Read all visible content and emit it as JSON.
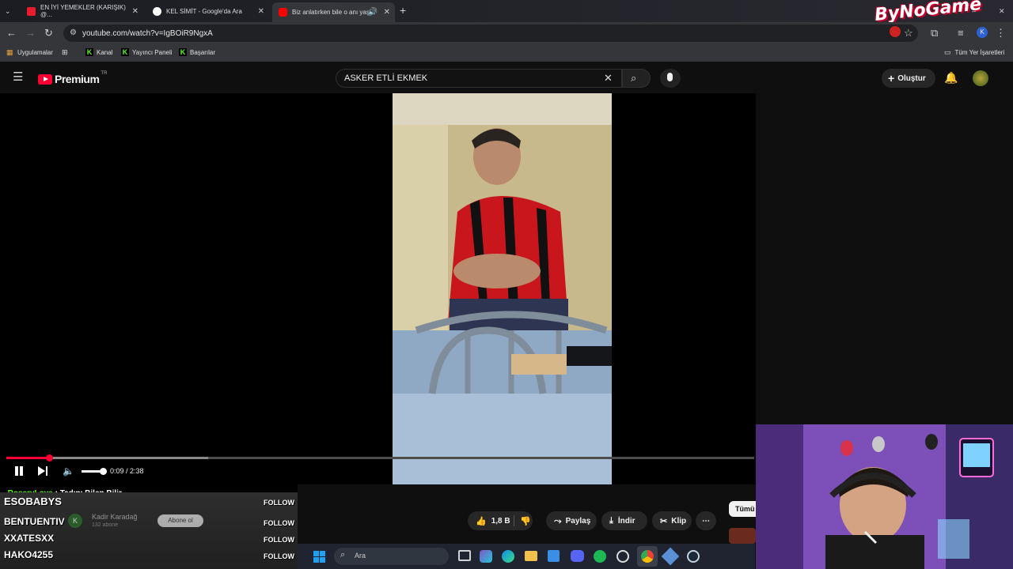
{
  "tabs": [
    {
      "title": "EN İYİ YEMEKLER (KARIŞIK) @...",
      "favicon_color": "#e81c2e"
    },
    {
      "title": "KEL SİMİT - Google'da Ara",
      "favicon_color": "#ffffff"
    },
    {
      "title": "Biz anlatırken bile o anı yaş...",
      "favicon_color": "#ff0000"
    }
  ],
  "brand_logo": "ByNoGame",
  "address": {
    "url": "youtube.com/watch?v=IgBOiR9NgxA"
  },
  "bookmarks": {
    "apps": "Uygulamalar",
    "items": [
      "Kanal",
      "Yayıncı Paneli",
      "Başarılar"
    ],
    "all_bookmarks": "Tüm Yer İşaretleri"
  },
  "youtube": {
    "logo_text": "Premium",
    "region": "TR",
    "search_query": "ASKER ETLİ EKMEK",
    "create_label": "Oluştur"
  },
  "player": {
    "time_current": "0:09",
    "time_total": "2:38",
    "time_sep": " / ",
    "progress": 0.057,
    "buffered": 0.27,
    "volume": 0.85
  },
  "chat": {
    "message_user": "RosaryLove",
    "message_sep": " : ",
    "message_text": "Tadını Bilen Bilir",
    "follow_label": "FOLLOW",
    "followers": [
      "ESOBABYS",
      "BENTUENTIV",
      "XXATESXX",
      "HAKO4255"
    ]
  },
  "channel": {
    "name": "Kadir Karadağ",
    "subs": "132 abone",
    "subscribe_label": "Abone ol"
  },
  "actions": {
    "likes": "1,8 B",
    "share": "Paylaş",
    "download": "İndir",
    "clip": "Klip",
    "all_label": "Tümü"
  },
  "taskbar": {
    "search_placeholder": "Ara"
  },
  "colors": {
    "youtube_red": "#ff0033",
    "kick_green": "#53fc18"
  }
}
